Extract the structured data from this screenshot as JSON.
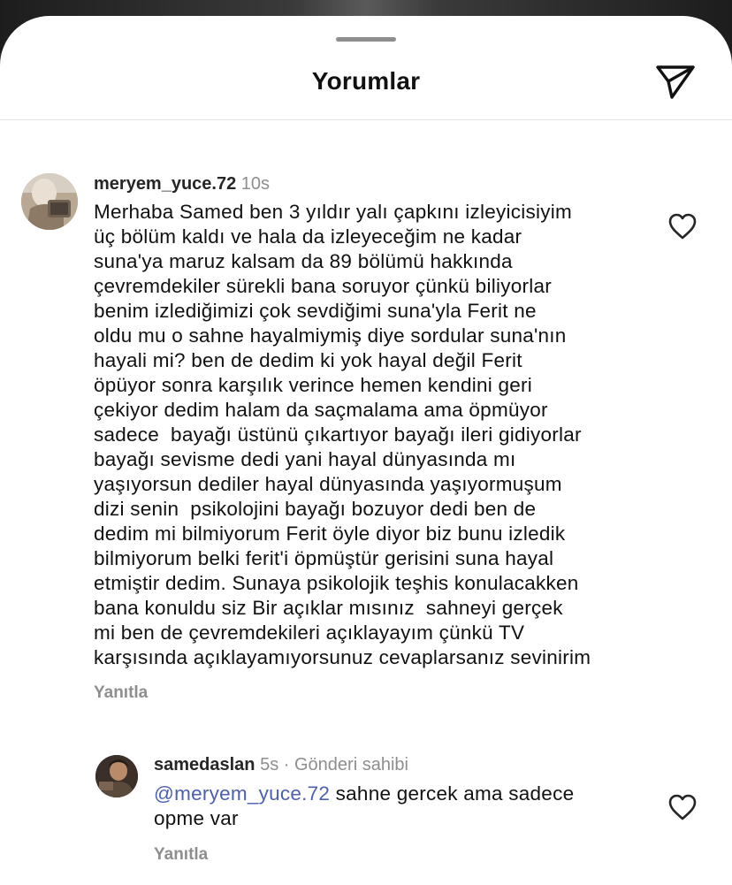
{
  "header": {
    "title": "Yorumlar",
    "share_icon": "paper-plane-icon"
  },
  "comments": [
    {
      "username": "meryem_yuce.72",
      "time": "10s",
      "text": "Merhaba Samed ben 3 yıldır yalı çapkını izleyicisiyim\nüç bölüm kaldı ve hala da izleyeceğim ne kadar\nsuna'ya maruz kalsam da 89 bölümü hakkında\nçevremdekiler sürekli bana soruyor çünkü biliyorlar\nbenim izlediğimizi çok sevdiğimi suna'yla Ferit ne\noldu mu o sahne hayalmiymiş diye sordular suna'nın\nhayali mi? ben de dedim ki yok hayal değil Ferit\nöpüyor sonra karşılık verince hemen kendini geri\nçekiyor dedim halam da saçmalama ama öpmüyor\nsadece  bayağı üstünü çıkartıyor bayağı ileri gidiyorlar\nbayağı sevisme dedi yani hayal dünyasında mı\nyaşıyorsun dediler hayal dünyasında yaşıyormuşum\ndizi senin  psikolojini bayağı bozuyor dedi ben de\ndedim mi bilmiyorum Ferit öyle diyor biz bunu izledik\nbilmiyorum belki ferit'i öpmüştür gerisini suna hayal\netmiştir dedim. Sunaya psikolojik teşhis konulacakken\nbana konuldu siz Bir açıklar mısınız  sahneyi gerçek\nmi ben de çevremdekileri açıklayayım çünkü TV\nkarşısında açıklayamıyorsunuz cevaplarsanız sevinirim",
      "reply_label": "Yanıtla",
      "like_icon": "heart-outline-icon"
    }
  ],
  "replies": [
    {
      "username": "samedaslan",
      "time": "5s",
      "separator": "·",
      "badge": "Gönderi sahibi",
      "mention": "@meryem_yuce.72",
      "text_first_line": " sahne gercek ama sadece",
      "text_rest": "opme var",
      "reply_label": "Yanıtla",
      "like_icon": "heart-outline-icon"
    }
  ]
}
